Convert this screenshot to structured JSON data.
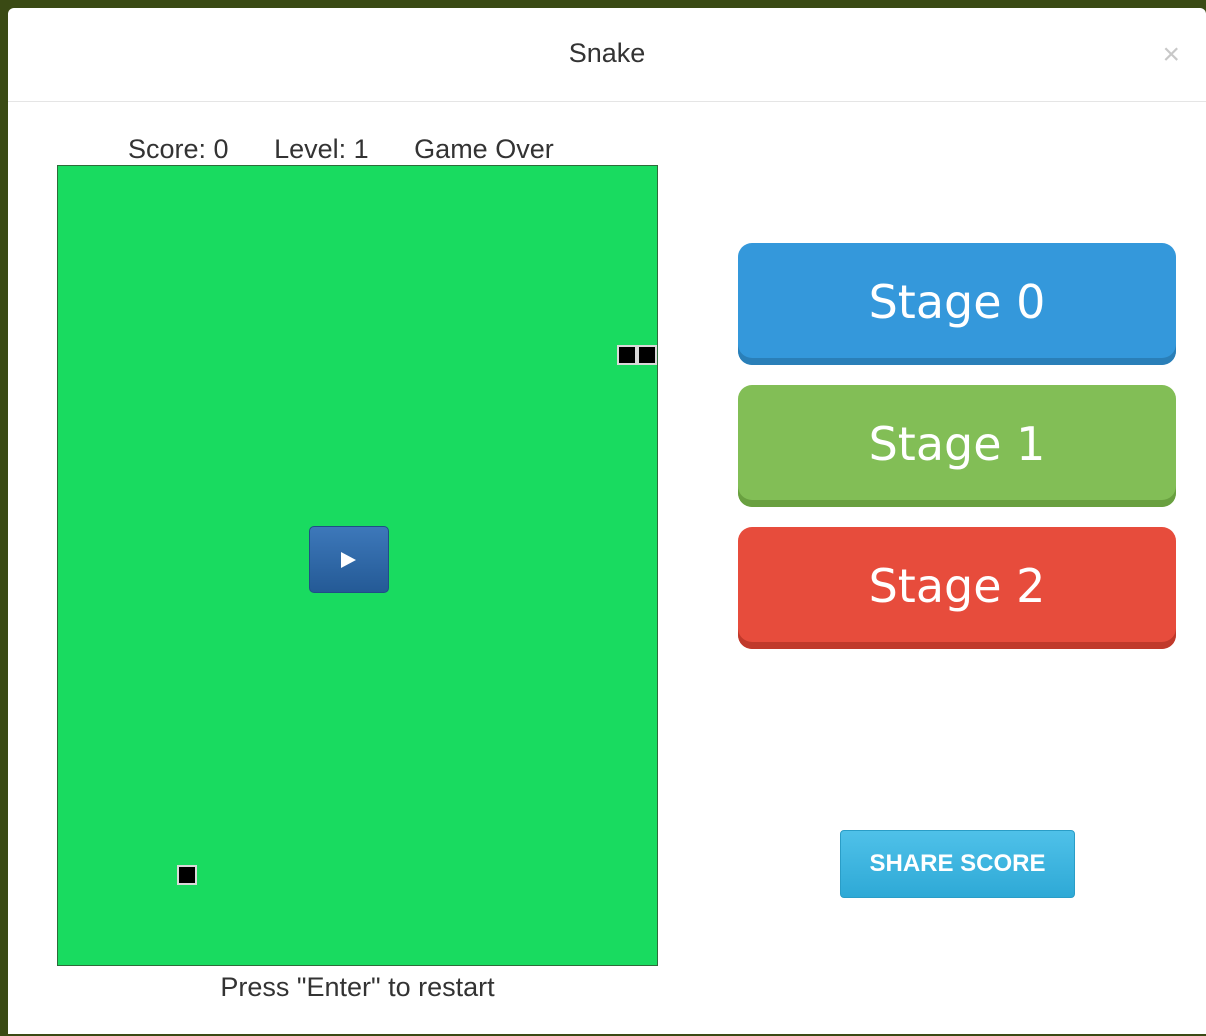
{
  "modal": {
    "title": "Snake",
    "close_symbol": "×"
  },
  "status": {
    "score": "Score: 0",
    "level": "Level: 1",
    "state": "Game Over"
  },
  "board": {
    "color": "#19db60",
    "snake_cells": 2,
    "food_cells": 1
  },
  "play_button": {
    "icon": "play-icon"
  },
  "footer": {
    "text": "Press \"Enter\" to restart"
  },
  "stages": [
    {
      "label": "Stage 0",
      "color": "#3498db"
    },
    {
      "label": "Stage 1",
      "color": "#82be56"
    },
    {
      "label": "Stage 2",
      "color": "#e74c3c"
    }
  ],
  "share": {
    "label": "SHARE SCORE"
  }
}
